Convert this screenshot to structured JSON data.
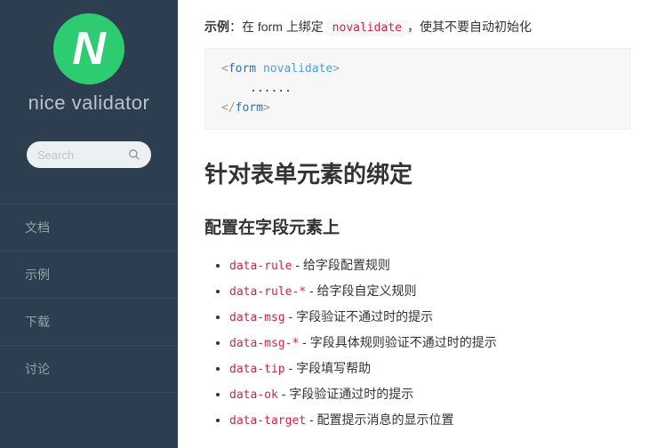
{
  "sidebar": {
    "logo_letter": "N",
    "brand": "nice validator",
    "search_placeholder": "Search",
    "nav": [
      "文档",
      "示例",
      "下载",
      "讨论"
    ]
  },
  "content": {
    "example_label": "示例",
    "example_text_before": "：在 form 上绑定 ",
    "example_code": "novalidate",
    "example_text_after": "，使其不要自动初始化",
    "codeblock": {
      "open_punc1": "<",
      "open_tag": "form",
      "open_attr": " novalidate",
      "open_punc2": ">",
      "body": "......",
      "close_punc1": "</",
      "close_tag": "form",
      "close_punc2": ">"
    },
    "section_title": "针对表单元素的绑定",
    "subsection_title": "配置在字段元素上",
    "attrs": [
      {
        "name": "data-rule",
        "desc": " - 给字段配置规则"
      },
      {
        "name": "data-rule-*",
        "desc": " - 给字段自定义规则"
      },
      {
        "name": "data-msg",
        "desc": " - 字段验证不通过时的提示"
      },
      {
        "name": "data-msg-*",
        "desc": " - 字段具体规则验证不通过时的提示"
      },
      {
        "name": "data-tip",
        "desc": " - 字段填写帮助"
      },
      {
        "name": "data-ok",
        "desc": " - 字段验证通过时的提示"
      },
      {
        "name": "data-target",
        "desc": " - 配置提示消息的显示位置"
      }
    ]
  }
}
